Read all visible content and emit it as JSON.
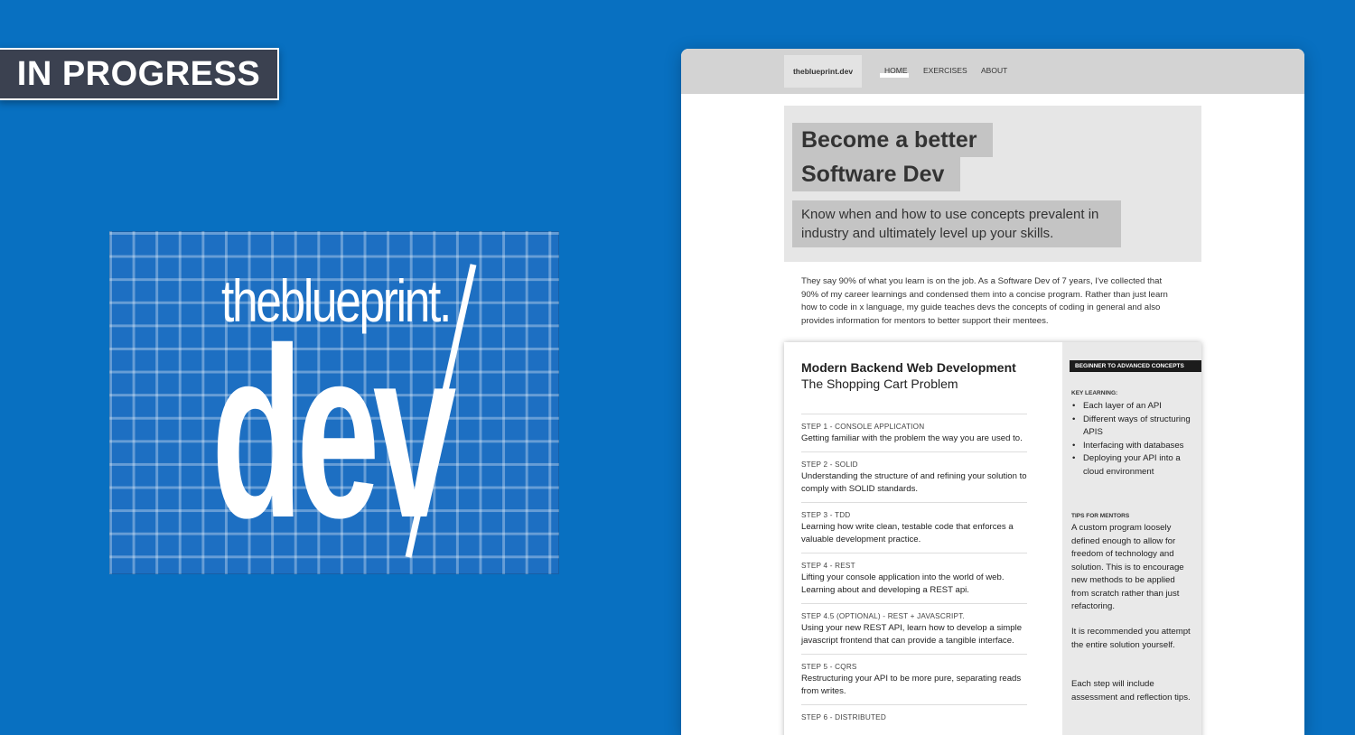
{
  "badge": {
    "label": "IN PROGRESS"
  },
  "logo": {
    "top": "theblueprint.",
    "bottom": "dev"
  },
  "site": {
    "brand": "theblueprint.dev",
    "nav": [
      "HOME",
      "EXERCISES",
      "ABOUT"
    ],
    "active_nav": "HOME",
    "hero": {
      "line1": "Become a better",
      "line2": "Software Dev",
      "subtitle": "Know when and how to use concepts prevalent in industry and ultimately level up your skills."
    },
    "intro": "They say 90% of what you learn is on the job. As a Software Dev of 7 years, I've collected that 90% of my career learnings and condensed them into a concise program. Rather than just learn how to code in x language, my guide teaches devs the concepts of coding in general and also provides information for mentors to better support their mentees.",
    "course": {
      "title": "Modern Backend Web Development",
      "subtitle": "The Shopping Cart Problem",
      "steps": [
        {
          "label": "STEP 1 - CONSOLE APPLICATION",
          "desc": "Getting familiar with the problem the way you are used to."
        },
        {
          "label": "STEP 2 - SOLID",
          "desc": "Understanding the structure of and refining your solution to comply with SOLID standards."
        },
        {
          "label": "STEP 3 - TDD",
          "desc": "Learning how write clean, testable code that enforces a valuable development practice."
        },
        {
          "label": "STEP 4 - REST",
          "desc": "Lifting your console application into the world of web. Learning about and developing a REST api."
        },
        {
          "label": "STEP 4.5 (OPTIONAL) - REST + JAVASCRIPT.",
          "desc": "Using your new REST API, learn how to develop a simple javascript frontend that can provide a tangible interface."
        },
        {
          "label": "STEP 5 - CQRS",
          "desc": "Restructuring your API to be more pure, separating reads from writes."
        },
        {
          "label": "STEP 6 - DISTRIBUTED",
          "desc": ""
        }
      ],
      "sidebar": {
        "pill": "BEGINNER TO ADVANCED CONCEPTS",
        "key_heading": "KEY LEARNING:",
        "key_items": [
          "Each layer of an API",
          "Different ways of structuring APIS",
          "Interfacing with databases",
          "Deploying your API into a cloud environment"
        ],
        "tips_heading": "TIPS FOR MENTORS",
        "tips_p1": "A custom program loosely defined enough to allow for freedom of technology and solution. This is to encourage new methods to be applied from scratch rather than just refactoring.",
        "tips_p2": "It is recommended you attempt the entire solution yourself.",
        "tips_p3": "Each step will include assessment and reflection tips."
      }
    }
  },
  "colors": {
    "background": "#0870c1",
    "badge": "#3b4150",
    "nav": "#d3d3d3",
    "hero": "#e6e6e6",
    "pill": "#1c1c1c"
  }
}
